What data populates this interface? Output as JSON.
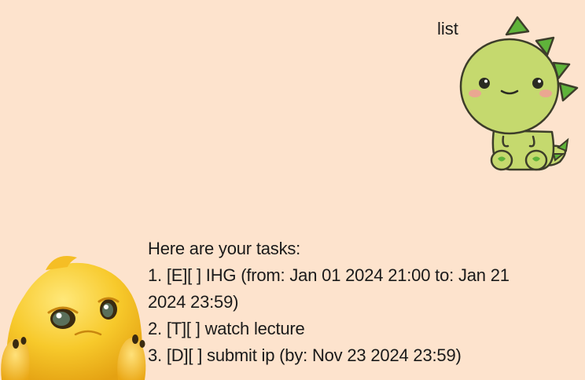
{
  "conversation": {
    "user_message": {
      "text": "list",
      "avatar_icon": "green-dinosaur-avatar-icon"
    },
    "bot_message": {
      "avatar_icon": "yellow-creature-avatar-icon",
      "lines": [
        "Here are your tasks:",
        "1. [E][ ] IHG (from: Jan 01 2024 21:00 to: Jan 21",
        "2024 23:59)",
        "2. [T][ ] watch lecture",
        "3. [D][ ] submit ip (by: Nov 23 2024 23:59)"
      ]
    }
  },
  "colors": {
    "background": "#fde3cd",
    "text": "#1a1a1a",
    "dino_body": "#c5d96e",
    "dino_spikes": "#5fb33a",
    "creature_body": "#f7c92b"
  }
}
